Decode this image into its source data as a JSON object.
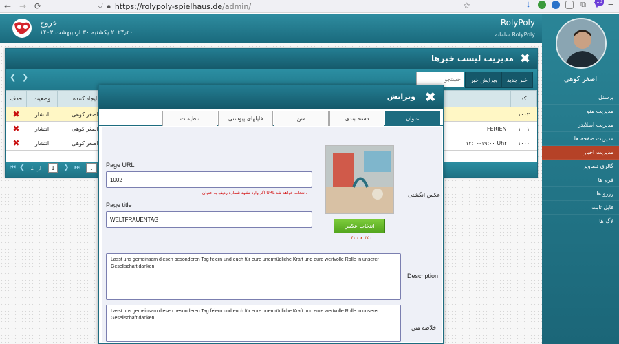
{
  "browser": {
    "url_host": "https://rolypoly-spielhaus.de",
    "url_path": "/admin/",
    "ext_badge": "18"
  },
  "header": {
    "logout": "خروج",
    "date": "یکشنبه ۳۰ اردیبهشت ۱۴۰۳ ‎۲۰۲۴٫۲۰",
    "brand": "RolyPoly",
    "brand_sub": "سامانه RolyPoly"
  },
  "sidebar": {
    "user_name": "اصغر کوهی",
    "items": [
      {
        "label": "پرسنل"
      },
      {
        "label": "مدیریت منو"
      },
      {
        "label": "مدیریت اسلایدر"
      },
      {
        "label": "مدیریت صفحه ها"
      },
      {
        "label": "مدیریت اخبار"
      },
      {
        "label": "گالری تصاویر"
      },
      {
        "label": "فرم ها"
      },
      {
        "label": "رزرو ها"
      },
      {
        "label": "فایل ثابت"
      },
      {
        "label": "لاگ ها"
      }
    ],
    "active_index": 4
  },
  "list_window": {
    "title": "مدیریت لیست خبرها",
    "new_button": "خبر جدید",
    "edit_button": "ویرایش خبر",
    "search_placeholder": "جستجو",
    "columns": {
      "id": "کد",
      "creator": "ایجاد کننده",
      "status": "وضعیت",
      "delete": "حذف"
    },
    "rows": [
      {
        "id": "۱۰۰۲",
        "creator": "اصغر کوهی",
        "status": "انتشار",
        "note": ""
      },
      {
        "id": "۱۰۰۱",
        "creator": "اصغر کوهی",
        "status": "انتشار",
        "note": "FERIEN"
      },
      {
        "id": "۱۰۰۰",
        "creator": "اصغر کوهی",
        "status": "انتشار",
        "note": "۱۲:۰۰-۱۹:۰۰ Uhr"
      }
    ],
    "pager": {
      "page": "1",
      "of": "از",
      "total": "1"
    }
  },
  "modal": {
    "title": "ویرایش",
    "tabs": [
      {
        "label": "عنوان"
      },
      {
        "label": "دسته بندی"
      },
      {
        "label": "متن"
      },
      {
        "label": "فایلهای پیوستی"
      },
      {
        "label": "تنظیمات"
      }
    ],
    "page_url_label": "Page URL",
    "page_url_value": "1002",
    "url_hint": "اگر وارد نشود شماره ردیف به عنوان URL انتخاب خواهد شد.",
    "page_title_label": "Page title",
    "page_title_value": "WELTFRAUENTAG",
    "thumb_label": "عکس انگشتی",
    "choose_button": "انتخاب عکس",
    "thumb_dims": "۴۰۰ x ۳۵۰",
    "description_label": "Description",
    "description_value": "Lasst uns gemeinsam diesen besonderen Tag feiern und euch für eure unermüdliche Kraft und eure wertvolle Rolle in unserer Gesellschaft danken.",
    "summary_label": "خلاصه متن",
    "summary_value": "Lasst uns gemeinsam diesen besonderen Tag feiern und euch für eure unermüdliche Kraft und eure wertvolle Rolle in unserer Gesellschaft danken."
  },
  "colors": {
    "teal": "#1d6c80",
    "active_menu": "#b54227",
    "highlight_row": "#fff7c5"
  }
}
